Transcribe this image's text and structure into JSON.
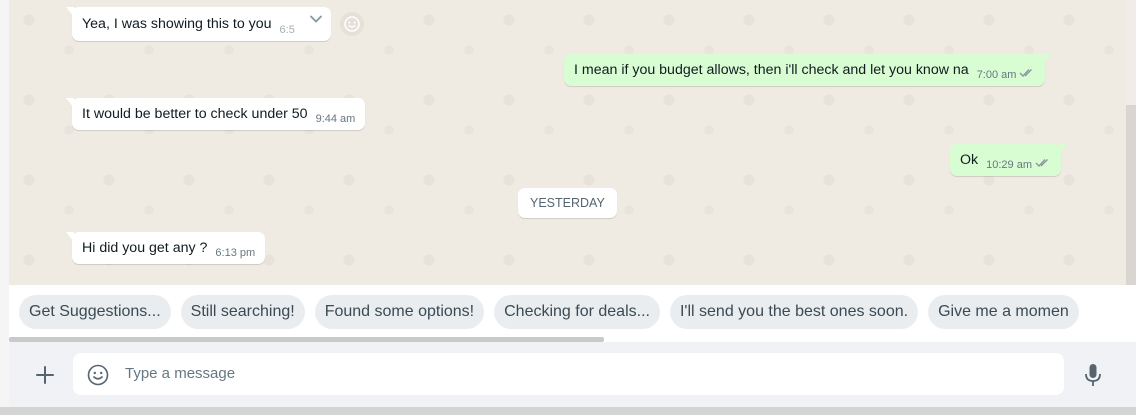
{
  "messages": [
    {
      "direction": "in",
      "text": "Yea, I was showing this to you",
      "time": "6:5"
    },
    {
      "direction": "out",
      "text": "I mean if you budget allows, then i'll check and let you know na",
      "time": "7:00 am"
    },
    {
      "direction": "in",
      "text": "It would be better to check under 50",
      "time": "9:44 am"
    },
    {
      "direction": "out",
      "text": "Ok",
      "time": "10:29 am"
    },
    {
      "direction": "in",
      "text": "Hi did you get any ?",
      "time": "6:13 pm"
    }
  ],
  "date_separator": "YESTERDAY",
  "suggestions": [
    "Get Suggestions...",
    "Still searching!",
    "Found some options!",
    "Checking for deals...",
    "I'll send you the best ones soon.",
    "Give me a momen"
  ],
  "composer": {
    "placeholder": "Type a message"
  },
  "icons": {
    "message_menu": "chevron-down-icon",
    "reaction": "emoji-icon",
    "attach": "plus-icon",
    "emoji": "emoji-icon",
    "mic": "microphone-icon",
    "read_receipt": "double-check-icon"
  },
  "colors": {
    "outgoing_bubble": "#d9fdd3",
    "incoming_bubble": "#ffffff",
    "chat_background": "#efeae2",
    "chip_background": "#e9edef"
  }
}
